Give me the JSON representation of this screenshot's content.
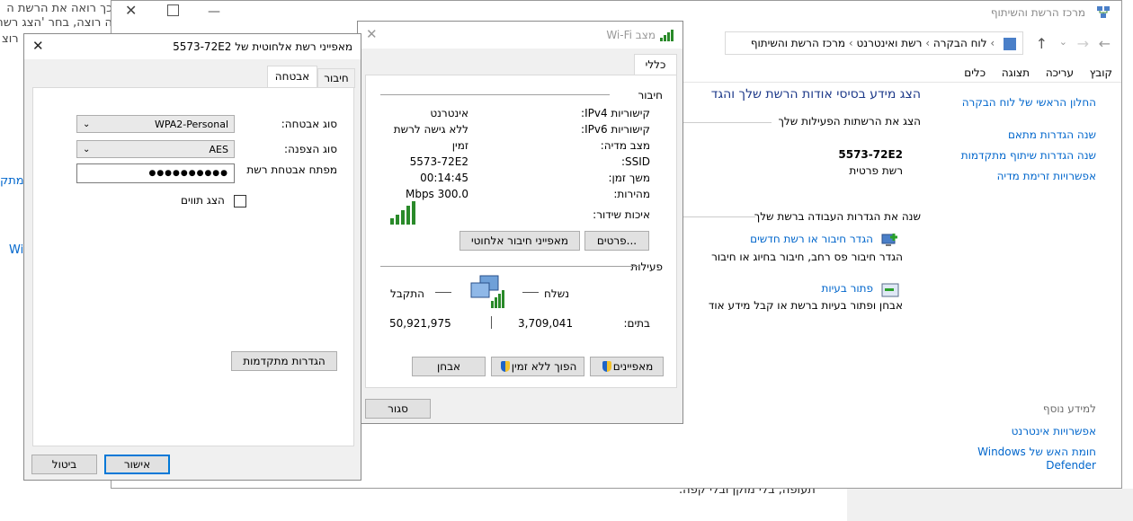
{
  "bg_text": {
    "line1": "כך רואה את הרשת ה",
    "line2": "ה רוצה, בחר 'הצג רשת",
    "line3": "רוצ",
    "left_link1": "מתק",
    "left_link2": "Wi",
    "bottom_text": "תעופה, בלי מוקן ובלי קפה."
  },
  "control_panel": {
    "title": "מרכז הרשת והשיתוף",
    "breadcrumb": [
      "לוח הבקרה",
      "רשת ואינטרנט",
      "מרכז הרשת והשיתוף"
    ],
    "menu": [
      "קובץ",
      "עריכה",
      "תצוגה",
      "כלים"
    ],
    "sidebar_links": [
      "החלון הראשי של לוח הבקרה",
      "שנה הגדרות מתאם",
      "שנה הגדרות שיתוף מתקדמות",
      "אפשרויות זרימת מדיה"
    ],
    "see_also": "למידע נוסף",
    "see_also_links": [
      "אפשרויות אינטרנט",
      "חומת האש של Windows",
      "Defender"
    ],
    "heading": "הצג מידע בסיסי אודות הרשת שלך והגד",
    "active_networks": "הצג את הרשתות הפעילות שלך",
    "network_name": "5573-72E2",
    "network_type": "רשת פרטית",
    "change_settings": "שנה את הגדרות העבודה ברשת שלך",
    "setup_link": "הגדר חיבור או רשת חדשים",
    "setup_desc": "הגדר חיבור פס רחב, חיבור בחיוג או חיבור",
    "troubleshoot_link": "פתור בעיות",
    "troubleshoot_desc": "אבחן ופתור בעיות ברשת או קבל מידע אוד"
  },
  "wifi_status": {
    "title": "מצב Wi-Fi",
    "tab": "כללי",
    "connection_heading": "חיבור",
    "rows": [
      {
        "label": "קישוריות IPv4:",
        "value": "אינטרנט"
      },
      {
        "label": "קישוריות IPv6:",
        "value": "ללא גישה לרשת"
      },
      {
        "label": "מצב מדיה:",
        "value": "זמין"
      },
      {
        "label": "SSID:",
        "value": "5573-72E2"
      },
      {
        "label": "משך זמן:",
        "value": "00:14:45"
      },
      {
        "label": "מהירות:",
        "value": "300.0 Mbps"
      }
    ],
    "signal_label": "איכות שידור:",
    "details_button": "פרטים...",
    "wireless_props_button": "מאפייני חיבור אלחוטי",
    "activity_heading": "פעילות",
    "sent_label": "נשלח",
    "received_label": "התקבל",
    "bytes_label": "בתים:",
    "sent_value": "3,709,041",
    "received_value": "50,921,975",
    "properties_button": "מאפיינים",
    "disable_button": "הפוך ללא זמין",
    "diagnose_button": "אבחן",
    "close_button": "סגור"
  },
  "wireless_props": {
    "title": "מאפייני רשת אלחוטית של 5573-72E2",
    "tabs": [
      "חיבור",
      "אבטחה"
    ],
    "security_type_label": "סוג אבטחה:",
    "security_type_value": "WPA2-Personal",
    "encryption_type_label": "סוג הצפנה:",
    "encryption_type_value": "AES",
    "key_label": "מפתח אבטחת רשת",
    "key_value": "●●●●●●●●●●",
    "show_chars_label": "הצג תווים",
    "advanced_button": "הגדרות מתקדמות",
    "ok_button": "אישור",
    "cancel_button": "ביטול"
  }
}
